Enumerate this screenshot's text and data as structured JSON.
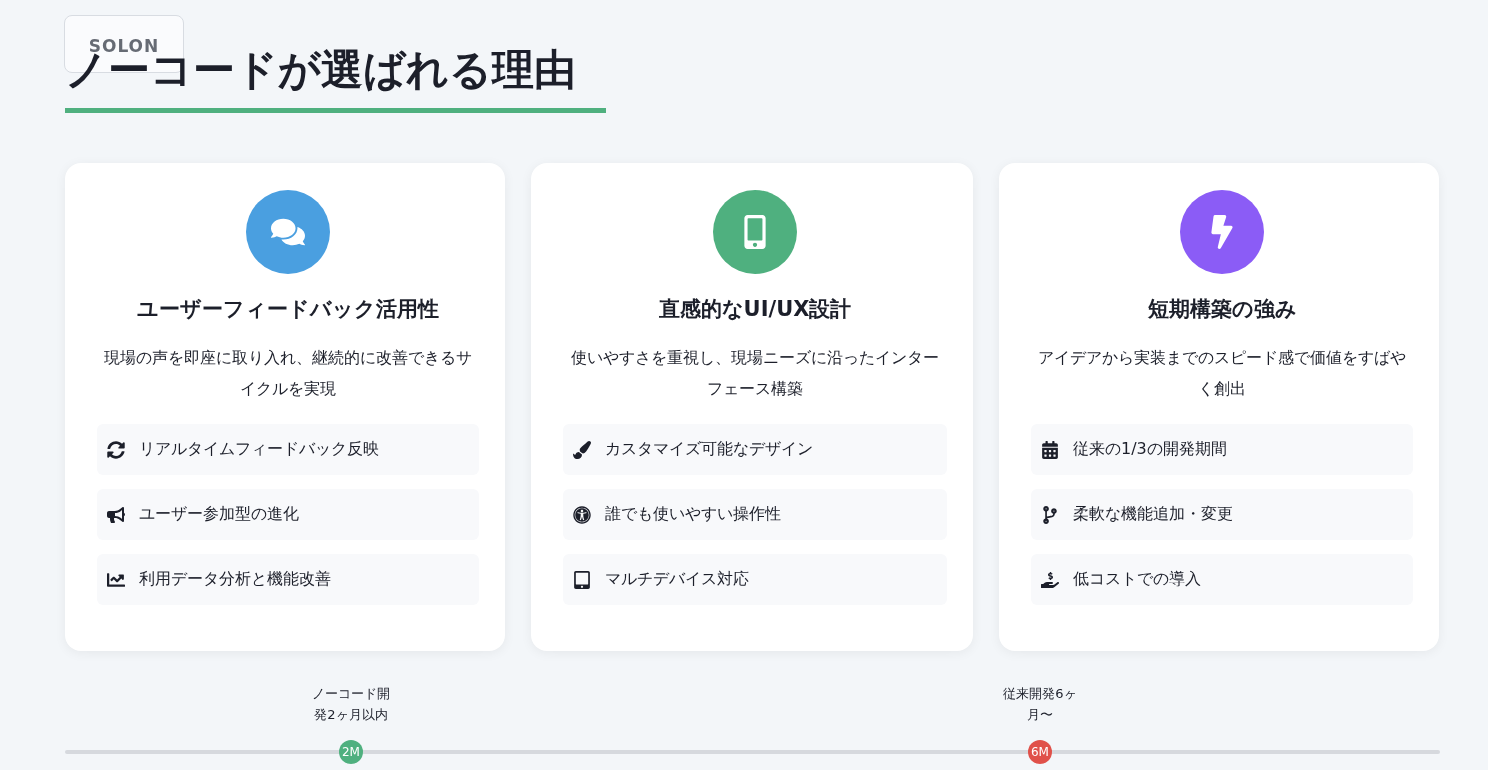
{
  "badge": "SOLON",
  "title": "ノーコードが選ばれる理由",
  "cards": [
    {
      "title": "ユーザーフィードバック活用性",
      "color": "#4a9fe0",
      "description": "現場の声を即座に取り入れ、継続的に改善できるサイクルを実現",
      "features": [
        "リアルタイムフィードバック反映",
        "ユーザー参加型の進化",
        "利用データ分析と機能改善"
      ]
    },
    {
      "title": "直感的なUI/UX設計",
      "color": "#4fb07f",
      "description": "使いやすさを重視し、現場ニーズに沿ったインターフェース構築",
      "features": [
        "カスタマイズ可能なデザイン",
        "誰でも使いやすい操作性",
        "マルチデバイス対応"
      ]
    },
    {
      "title": "短期構築の強み",
      "color": "#8b5cf6",
      "description": "アイデアから実装までのスピード感で価値をすばやく創出",
      "features": [
        "従来の1/3の開発期間",
        "柔軟な機能追加・変更",
        "低コストでの導入"
      ]
    }
  ],
  "timeline": [
    {
      "label": "ノーコード開発2ヶ月以内",
      "marker": "2M",
      "color": "#4fb07f",
      "level": 0.208
    },
    {
      "label": "従来開発6ヶ月〜",
      "marker": "6M",
      "color": "#e0514a",
      "level": 0.709
    }
  ]
}
